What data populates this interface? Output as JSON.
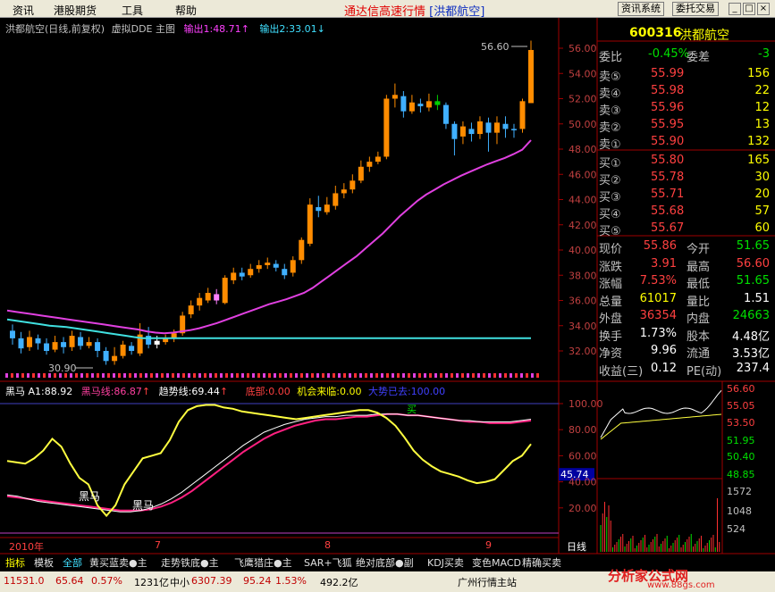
{
  "menu": [
    "资讯",
    "港股期货",
    "工具",
    "帮助"
  ],
  "app_title": "通达信高速行情",
  "app_title_stock": "[洪都航空]",
  "toolbar_buttons": [
    "资讯系统",
    "委托交易"
  ],
  "window_buttons": [
    "_",
    "□",
    "×"
  ],
  "main_header": {
    "stock": "洪都航空(日线,前复权)",
    "indicator": "虚拟DDE 主图",
    "out1": "输出1:48.71",
    "out2": "输出2:33.01"
  },
  "price_axis": [
    "56.00",
    "54.00",
    "52.00",
    "50.00",
    "48.00",
    "46.00",
    "44.00",
    "42.00",
    "40.00",
    "38.00",
    "36.00",
    "34.00",
    "32.00"
  ],
  "annotations": {
    "high": "56.60",
    "low": "30.90"
  },
  "sub_header": {
    "a1": "黑马 A1:88.92",
    "line1": "黑马线:86.87",
    "line2": "趋势线:69.44",
    "bottom": "底部:0.00",
    "chance": "机会来临:0.00",
    "trend": "大势已去:100.00"
  },
  "sub_axis": [
    "100.00",
    "80.00",
    "60.00",
    "45.74",
    "40.00",
    "20.00"
  ],
  "sub_labels": [
    "黑马",
    "黑马",
    "买"
  ],
  "date_axis": [
    "2010年",
    "7",
    "8",
    "9"
  ],
  "date_period": "日线",
  "quote": {
    "code": "600316",
    "name": "洪都航空",
    "wei_bi_label": "委比",
    "wei_bi": "-0.45%",
    "wei_cha_label": "委差",
    "wei_cha": "-3",
    "asks": [
      {
        "label": "卖⑤",
        "price": "55.99",
        "vol": "156"
      },
      {
        "label": "卖④",
        "price": "55.98",
        "vol": "22"
      },
      {
        "label": "卖③",
        "price": "55.96",
        "vol": "12"
      },
      {
        "label": "卖②",
        "price": "55.95",
        "vol": "13"
      },
      {
        "label": "卖①",
        "price": "55.90",
        "vol": "132"
      }
    ],
    "bids": [
      {
        "label": "买①",
        "price": "55.80",
        "vol": "165"
      },
      {
        "label": "买②",
        "price": "55.78",
        "vol": "30"
      },
      {
        "label": "买③",
        "price": "55.71",
        "vol": "20"
      },
      {
        "label": "买④",
        "price": "55.68",
        "vol": "57"
      },
      {
        "label": "买⑤",
        "price": "55.67",
        "vol": "60"
      }
    ],
    "stats": [
      {
        "l1": "现价",
        "v1": "55.86",
        "c1": "#ff4040",
        "l2": "今开",
        "v2": "51.65",
        "c2": "#00e000"
      },
      {
        "l1": "涨跌",
        "v1": "3.91",
        "c1": "#ff4040",
        "l2": "最高",
        "v2": "56.60",
        "c2": "#ff4040"
      },
      {
        "l1": "涨幅",
        "v1": "7.53%",
        "c1": "#ff4040",
        "l2": "最低",
        "v2": "51.65",
        "c2": "#00e000"
      },
      {
        "l1": "总量",
        "v1": "61017",
        "c1": "#ffff00",
        "l2": "量比",
        "v2": "1.51",
        "c2": "#ffffff"
      },
      {
        "l1": "外盘",
        "v1": "36354",
        "c1": "#ff4040",
        "l2": "内盘",
        "v2": "24663",
        "c2": "#00e000"
      },
      {
        "l1": "换手",
        "v1": "1.73%",
        "c1": "#ffffff",
        "l2": "股本",
        "v2": "4.48亿",
        "c2": "#ffffff"
      },
      {
        "l1": "净资",
        "v1": "9.96",
        "c1": "#ffffff",
        "l2": "流通",
        "v2": "3.53亿",
        "c2": "#ffffff"
      },
      {
        "l1": "收益(三)",
        "v1": "0.12",
        "c1": "#ffffff",
        "l2": "PE(动)",
        "v2": "237.4",
        "c2": "#ffffff"
      }
    ]
  },
  "intraday_axis": [
    "56.60",
    "55.05",
    "53.50",
    "51.95",
    "50.40",
    "48.85",
    "1572",
    "1048",
    "524"
  ],
  "bottom_tabs": [
    "指标",
    "模板",
    "全部",
    "黄买蓝卖●主",
    "走势铁底●主",
    "飞鹰猎庄●主",
    "SAR+飞狐",
    "绝对底部●副",
    "KDJ买卖",
    "变色MACD",
    "精确买卖"
  ],
  "status_bar": {
    "index": "11531.0",
    "idx_chg": "65.64",
    "idx_pct": "0.57%",
    "idx_amt": "1231亿",
    "sme_label": "中小",
    "sme": "6307.39",
    "sme_chg": "95.24",
    "sme_pct": "1.53%",
    "sme_amt": "492.2亿",
    "site": "广州行情主站"
  },
  "watermark": {
    "text": "分析家公式网",
    "url": "www.88gs.com"
  },
  "chart_data": {
    "type": "candlestick",
    "title": "洪都航空(日线,前复权)",
    "candles": [
      {
        "o": 33.6,
        "c": 33.0,
        "h": 34.1,
        "l": 32.5
      },
      {
        "o": 33.0,
        "c": 32.2,
        "h": 33.5,
        "l": 31.8
      },
      {
        "o": 32.3,
        "c": 33.1,
        "h": 33.6,
        "l": 32.0
      },
      {
        "o": 33.0,
        "c": 32.6,
        "h": 33.3,
        "l": 32.1
      },
      {
        "o": 32.6,
        "c": 32.0,
        "h": 33.0,
        "l": 31.7
      },
      {
        "o": 32.1,
        "c": 32.7,
        "h": 33.2,
        "l": 31.9
      },
      {
        "o": 32.7,
        "c": 32.3,
        "h": 33.1,
        "l": 31.8
      },
      {
        "o": 32.3,
        "c": 33.2,
        "h": 33.6,
        "l": 32.0
      },
      {
        "o": 33.1,
        "c": 32.4,
        "h": 33.5,
        "l": 32.1
      },
      {
        "o": 32.4,
        "c": 32.7,
        "h": 33.1,
        "l": 32.2
      },
      {
        "o": 32.7,
        "c": 32.0,
        "h": 33.0,
        "l": 31.5
      },
      {
        "o": 32.0,
        "c": 31.2,
        "h": 32.3,
        "l": 30.9
      },
      {
        "o": 31.2,
        "c": 31.6,
        "h": 32.3,
        "l": 30.9
      },
      {
        "o": 31.6,
        "c": 32.5,
        "h": 32.8,
        "l": 31.4
      },
      {
        "o": 32.4,
        "c": 32.0,
        "h": 32.7,
        "l": 31.7
      },
      {
        "o": 31.8,
        "c": 33.3,
        "h": 34.2,
        "l": 31.6
      },
      {
        "o": 33.2,
        "c": 32.5,
        "h": 33.9,
        "l": 32.2
      },
      {
        "o": 32.5,
        "c": 32.8,
        "h": 33.2,
        "l": 32.2
      },
      {
        "o": 32.7,
        "c": 33.0,
        "h": 33.3,
        "l": 32.5
      },
      {
        "o": 33.0,
        "c": 33.4,
        "h": 33.7,
        "l": 32.7
      },
      {
        "o": 33.4,
        "c": 34.8,
        "h": 35.1,
        "l": 33.2
      },
      {
        "o": 34.9,
        "c": 35.6,
        "h": 36.0,
        "l": 34.6
      },
      {
        "o": 35.6,
        "c": 36.2,
        "h": 36.6,
        "l": 35.2
      },
      {
        "o": 36.0,
        "c": 36.6,
        "h": 37.0,
        "l": 35.8
      },
      {
        "o": 36.5,
        "c": 36.0,
        "h": 36.9,
        "l": 35.7
      },
      {
        "o": 35.8,
        "c": 37.8,
        "h": 38.0,
        "l": 35.7
      },
      {
        "o": 37.6,
        "c": 38.2,
        "h": 38.6,
        "l": 37.3
      },
      {
        "o": 38.2,
        "c": 37.9,
        "h": 38.6,
        "l": 37.6
      },
      {
        "o": 38.0,
        "c": 38.5,
        "h": 38.9,
        "l": 37.8
      },
      {
        "o": 38.5,
        "c": 38.8,
        "h": 39.2,
        "l": 38.2
      },
      {
        "o": 38.8,
        "c": 39.0,
        "h": 39.4,
        "l": 38.5
      },
      {
        "o": 38.9,
        "c": 38.6,
        "h": 39.2,
        "l": 38.3
      },
      {
        "o": 38.5,
        "c": 38.0,
        "h": 38.9,
        "l": 37.7
      },
      {
        "o": 38.2,
        "c": 39.2,
        "h": 39.5,
        "l": 37.9
      },
      {
        "o": 39.2,
        "c": 40.8,
        "h": 41.0,
        "l": 38.9
      },
      {
        "o": 40.5,
        "c": 43.6,
        "h": 44.1,
        "l": 40.3
      },
      {
        "o": 43.4,
        "c": 43.1,
        "h": 44.3,
        "l": 42.6
      },
      {
        "o": 43.0,
        "c": 43.6,
        "h": 44.2,
        "l": 42.8
      },
      {
        "o": 43.5,
        "c": 44.5,
        "h": 45.1,
        "l": 43.2
      },
      {
        "o": 44.5,
        "c": 44.8,
        "h": 45.3,
        "l": 44.1
      },
      {
        "o": 44.8,
        "c": 45.5,
        "h": 46.0,
        "l": 44.5
      },
      {
        "o": 45.5,
        "c": 46.6,
        "h": 47.1,
        "l": 45.3
      },
      {
        "o": 46.6,
        "c": 47.0,
        "h": 47.4,
        "l": 46.2
      },
      {
        "o": 47.0,
        "c": 47.4,
        "h": 47.8,
        "l": 46.8
      },
      {
        "o": 47.4,
        "c": 52.0,
        "h": 52.3,
        "l": 47.2
      },
      {
        "o": 52.0,
        "c": 52.3,
        "h": 53.2,
        "l": 51.3
      },
      {
        "o": 52.2,
        "c": 51.0,
        "h": 52.6,
        "l": 50.5
      },
      {
        "o": 51.0,
        "c": 51.7,
        "h": 52.3,
        "l": 50.8
      },
      {
        "o": 51.6,
        "c": 51.4,
        "h": 52.0,
        "l": 50.9
      },
      {
        "o": 51.3,
        "c": 51.8,
        "h": 52.4,
        "l": 51.0
      },
      {
        "o": 51.8,
        "c": 51.5,
        "h": 52.3,
        "l": 51.1
      },
      {
        "o": 51.5,
        "c": 50.0,
        "h": 51.7,
        "l": 49.6
      },
      {
        "o": 50.0,
        "c": 48.8,
        "h": 50.2,
        "l": 47.5
      },
      {
        "o": 49.0,
        "c": 49.8,
        "h": 50.2,
        "l": 48.4
      },
      {
        "o": 49.6,
        "c": 49.2,
        "h": 50.1,
        "l": 48.6
      },
      {
        "o": 49.2,
        "c": 50.2,
        "h": 50.6,
        "l": 48.8
      },
      {
        "o": 50.1,
        "c": 49.3,
        "h": 50.5,
        "l": 47.8
      },
      {
        "o": 49.3,
        "c": 50.1,
        "h": 50.6,
        "l": 48.4
      },
      {
        "o": 50.0,
        "c": 49.6,
        "h": 50.6,
        "l": 48.9
      },
      {
        "o": 49.6,
        "c": 49.5,
        "h": 50.0,
        "l": 48.9
      },
      {
        "o": 49.6,
        "c": 51.8,
        "h": 52.0,
        "l": 49.3
      },
      {
        "o": 51.65,
        "c": 55.86,
        "h": 56.6,
        "l": 51.65
      }
    ],
    "ma_long": [
      35.2,
      35.1,
      35.0,
      34.9,
      34.8,
      34.7,
      34.6,
      34.5,
      34.4,
      34.3,
      34.2,
      34.1,
      34.0,
      33.9,
      33.8,
      33.7,
      33.55,
      33.45,
      33.4,
      33.45,
      33.55,
      33.65,
      33.8,
      34.0,
      34.2,
      34.45,
      34.7,
      34.95,
      35.2,
      35.45,
      35.7,
      35.9,
      36.1,
      36.35,
      36.6,
      37.0,
      37.5,
      38.0,
      38.5,
      39.0,
      39.5,
      40.1,
      40.7,
      41.3,
      42.0,
      42.7,
      43.3,
      43.9,
      44.4,
      44.8,
      45.2,
      45.55,
      45.9,
      46.2,
      46.5,
      46.8,
      47.05,
      47.3,
      47.6,
      47.95,
      48.71
    ],
    "ma_short_cyan": [
      34.5,
      34.4,
      34.3,
      34.2,
      34.1,
      34.0,
      33.95,
      33.9,
      33.8,
      33.7,
      33.6,
      33.5,
      33.4,
      33.3,
      33.2,
      33.1,
      33.01,
      33.01,
      33.01,
      33.01
    ],
    "sub_series": {
      "yellow": [
        56,
        55,
        54,
        58,
        64,
        73,
        67,
        54,
        43,
        38,
        22,
        14,
        22,
        38,
        48,
        58,
        60,
        62,
        72,
        86,
        95,
        98,
        99,
        99,
        97,
        96,
        94,
        93,
        92,
        91,
        90,
        89,
        88,
        89,
        90,
        91,
        92,
        93,
        94,
        95,
        95,
        93,
        89,
        83,
        74,
        64,
        57,
        52,
        48,
        46,
        44,
        41,
        39,
        40,
        42,
        49,
        56,
        60,
        69
      ],
      "white": [
        30,
        29,
        27,
        25,
        24,
        23,
        22,
        21,
        20,
        19,
        18,
        17,
        17,
        18,
        20,
        23,
        27,
        32,
        38,
        44,
        50,
        56,
        62,
        68,
        73,
        78,
        81,
        84,
        86,
        88,
        89,
        90,
        90,
        91,
        91,
        91,
        92,
        92,
        92,
        91,
        91,
        90,
        89,
        88,
        87,
        87,
        86,
        86,
        86,
        86,
        87,
        88
      ],
      "pink": [
        29,
        28,
        27,
        26,
        25,
        24,
        23,
        22,
        21,
        20,
        19,
        18,
        18,
        18,
        19,
        21,
        24,
        28,
        33,
        39,
        45,
        51,
        57,
        63,
        68,
        73,
        77,
        80,
        83,
        85,
        87,
        88,
        88,
        89,
        90,
        90,
        91,
        92,
        92,
        91,
        91,
        90,
        89,
        88,
        87,
        86,
        86,
        85,
        85,
        85,
        86,
        87
      ]
    },
    "sub_ylim": [
      0,
      100
    ],
    "ylim": [
      30.9,
      56.6
    ]
  }
}
